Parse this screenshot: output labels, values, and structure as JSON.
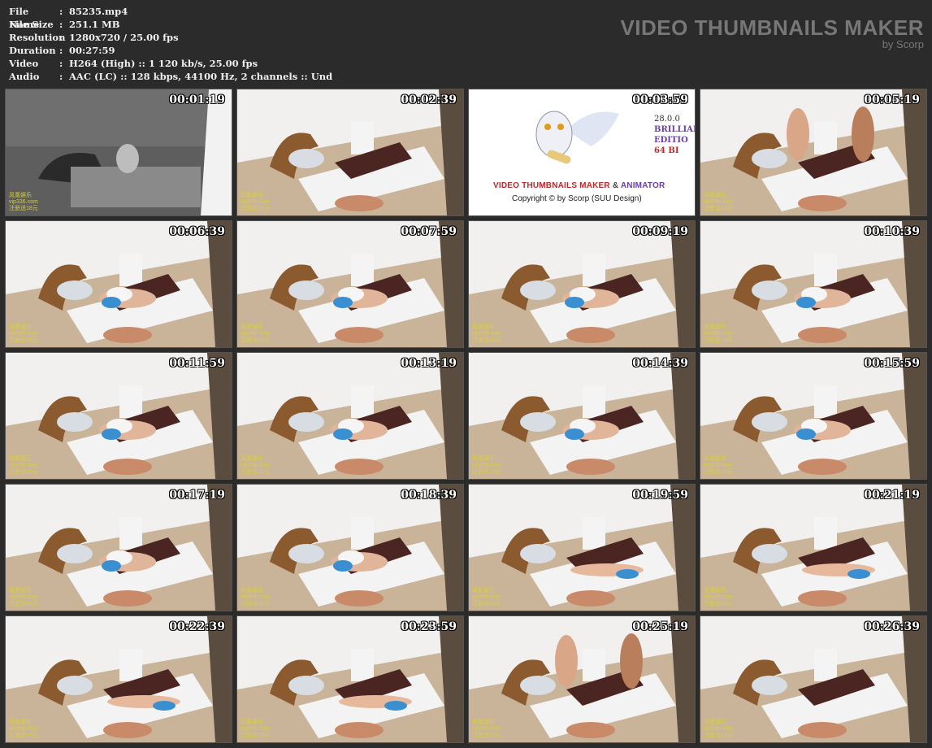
{
  "file_info": [
    {
      "label": "File Name",
      "value": "85235.mp4"
    },
    {
      "label": "File Size",
      "value": "251.1 MB"
    },
    {
      "label": "Resolution",
      "value": "1280x720 / 25.00 fps"
    },
    {
      "label": "Duration",
      "value": "00:27:59"
    },
    {
      "label": "Video",
      "value": "H264 (High) :: 1 120 kb/s, 25.00 fps"
    },
    {
      "label": "Audio",
      "value": "AAC (LC) :: 128 kbps, 44100 Hz, 2 channels :: Und"
    }
  ],
  "separator": ":",
  "brand": {
    "title": "VIDEO THUMBNAILS MAKER",
    "subtitle": "by Scorp"
  },
  "thumbnails": [
    {
      "time": "00:01:19",
      "scene": "night"
    },
    {
      "time": "00:02:39",
      "scene": "room"
    },
    {
      "time": "00:03:59",
      "scene": "logo"
    },
    {
      "time": "00:05:19",
      "scene": "standing"
    },
    {
      "time": "00:06:39",
      "scene": "couple"
    },
    {
      "time": "00:07:59",
      "scene": "couple"
    },
    {
      "time": "00:09:19",
      "scene": "couple"
    },
    {
      "time": "00:10:39",
      "scene": "couple"
    },
    {
      "time": "00:11:59",
      "scene": "couple"
    },
    {
      "time": "00:13:19",
      "scene": "couple"
    },
    {
      "time": "00:14:39",
      "scene": "couple"
    },
    {
      "time": "00:15:59",
      "scene": "couple"
    },
    {
      "time": "00:17:19",
      "scene": "couple"
    },
    {
      "time": "00:18:39",
      "scene": "couple"
    },
    {
      "time": "00:19:59",
      "scene": "lying"
    },
    {
      "time": "00:21:19",
      "scene": "lying"
    },
    {
      "time": "00:22:39",
      "scene": "lying"
    },
    {
      "time": "00:23:59",
      "scene": "lying"
    },
    {
      "time": "00:25:19",
      "scene": "standing"
    },
    {
      "time": "00:26:39",
      "scene": "room"
    }
  ],
  "logo_card": {
    "title_a": "VIDEO THUMBNAILS MAKER",
    "title_amp": " & ",
    "title_b": "ANIMATOR",
    "copyright": "Copyright © by Scorp (SUU Design)",
    "side_lines": [
      "28.0.0",
      "BRILLIANC",
      "EDITIO",
      "64 BI"
    ]
  },
  "watermark_lines": [
    "凤凰娱乐",
    "vip336.com",
    "注册送18元"
  ],
  "colors": {
    "background": "#2b2b2b",
    "text": "#f0f0f0",
    "brand": "#777777",
    "timestamp": "#ffffff"
  }
}
